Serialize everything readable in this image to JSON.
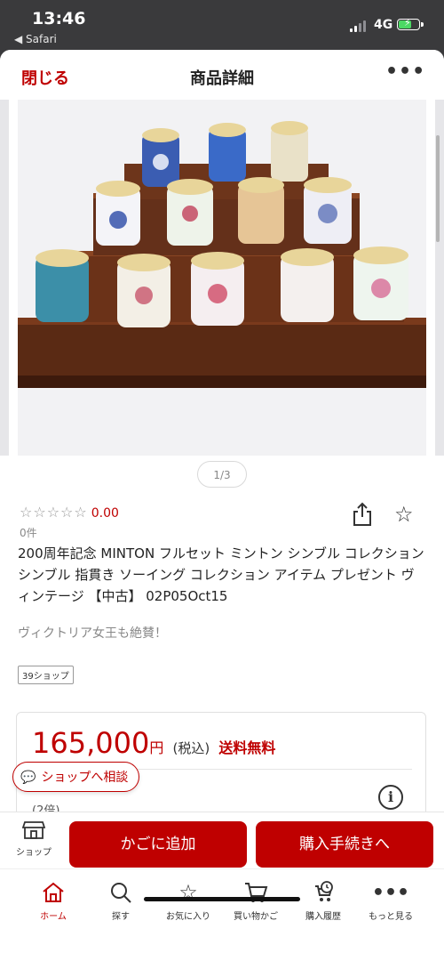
{
  "status": {
    "time": "13:46",
    "back_label": "◀ Safari",
    "network": "4G"
  },
  "header": {
    "close_label": "閉じる",
    "title": "商品詳細",
    "more_label": "•••"
  },
  "gallery": {
    "pager": "1/3"
  },
  "product": {
    "stars": "☆☆☆☆☆",
    "rating": "0.00",
    "review_count": "0件",
    "title": "200周年記念 MINTON フルセット ミントン シンブル コレクション シンブル 指貫き ソーイング コレクション アイテム プレゼント ヴィンテージ 【中古】 02P05Oct15",
    "catch_copy": "ヴィクトリア女王も絶賛！",
    "shop_badge": "39ショップ"
  },
  "price": {
    "amount": "165,000",
    "unit": "円",
    "tax": "(税込)",
    "shipping": "送料無料",
    "points_partial": "(2倍)"
  },
  "consult_button": {
    "label": "ショップへ相談"
  },
  "action_bar": {
    "shop_label": "ショップ",
    "add_to_cart": "かごに追加",
    "checkout": "購入手続きへ"
  },
  "tabbar": {
    "items": [
      {
        "label": "ホーム"
      },
      {
        "label": "探す"
      },
      {
        "label": "お気に入り"
      },
      {
        "label": "買い物かご"
      },
      {
        "label": "購入履歴"
      },
      {
        "label": "もっと見る"
      }
    ]
  },
  "colors": {
    "accent": "#bf0000",
    "battery": "#4cd964"
  },
  "icons": [
    "share-icon",
    "star-icon",
    "info-icon",
    "chat-icon",
    "shop-icon",
    "home-icon",
    "search-icon",
    "favorite-icon",
    "cart-icon",
    "history-icon",
    "more-icon"
  ]
}
